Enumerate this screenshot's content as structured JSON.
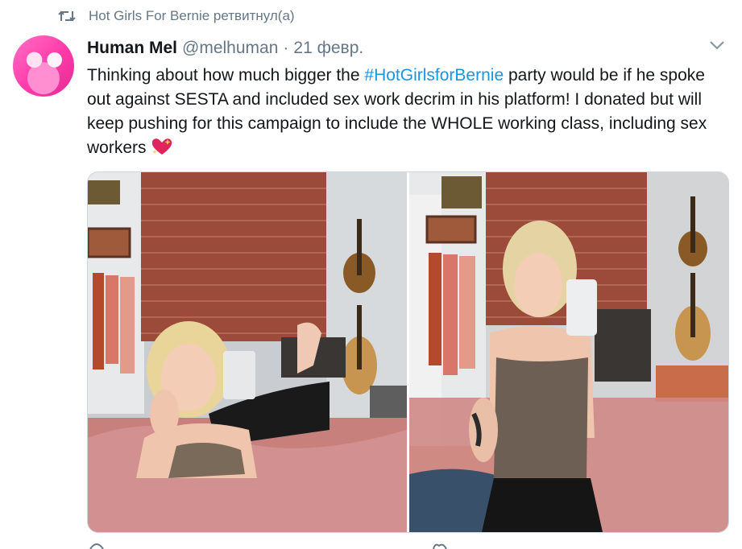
{
  "retweet": {
    "icon": "retweet-icon",
    "text": "Hot Girls For Bernie ретвитнул(а)"
  },
  "tweet": {
    "author_name": "Human Mel",
    "handle": "@melhuman",
    "separator": "·",
    "date": "21 февр.",
    "text_before": "Thinking about how much bigger the ",
    "hashtag": "#HotGirlsforBernie",
    "text_after": " party would be if he spoke out against SESTA and included sex work decrim in his platform! I donated but will keep pushing for this campaign to include the WHOLE working class, including sex workers ",
    "emoji": "sparkling-heart-emoji"
  },
  "colors": {
    "link": "#1b95e0",
    "muted": "#657786",
    "text": "#14171a"
  },
  "icons": [
    "retweet-icon",
    "chevron-down-icon",
    "reply-icon",
    "like-icon"
  ]
}
